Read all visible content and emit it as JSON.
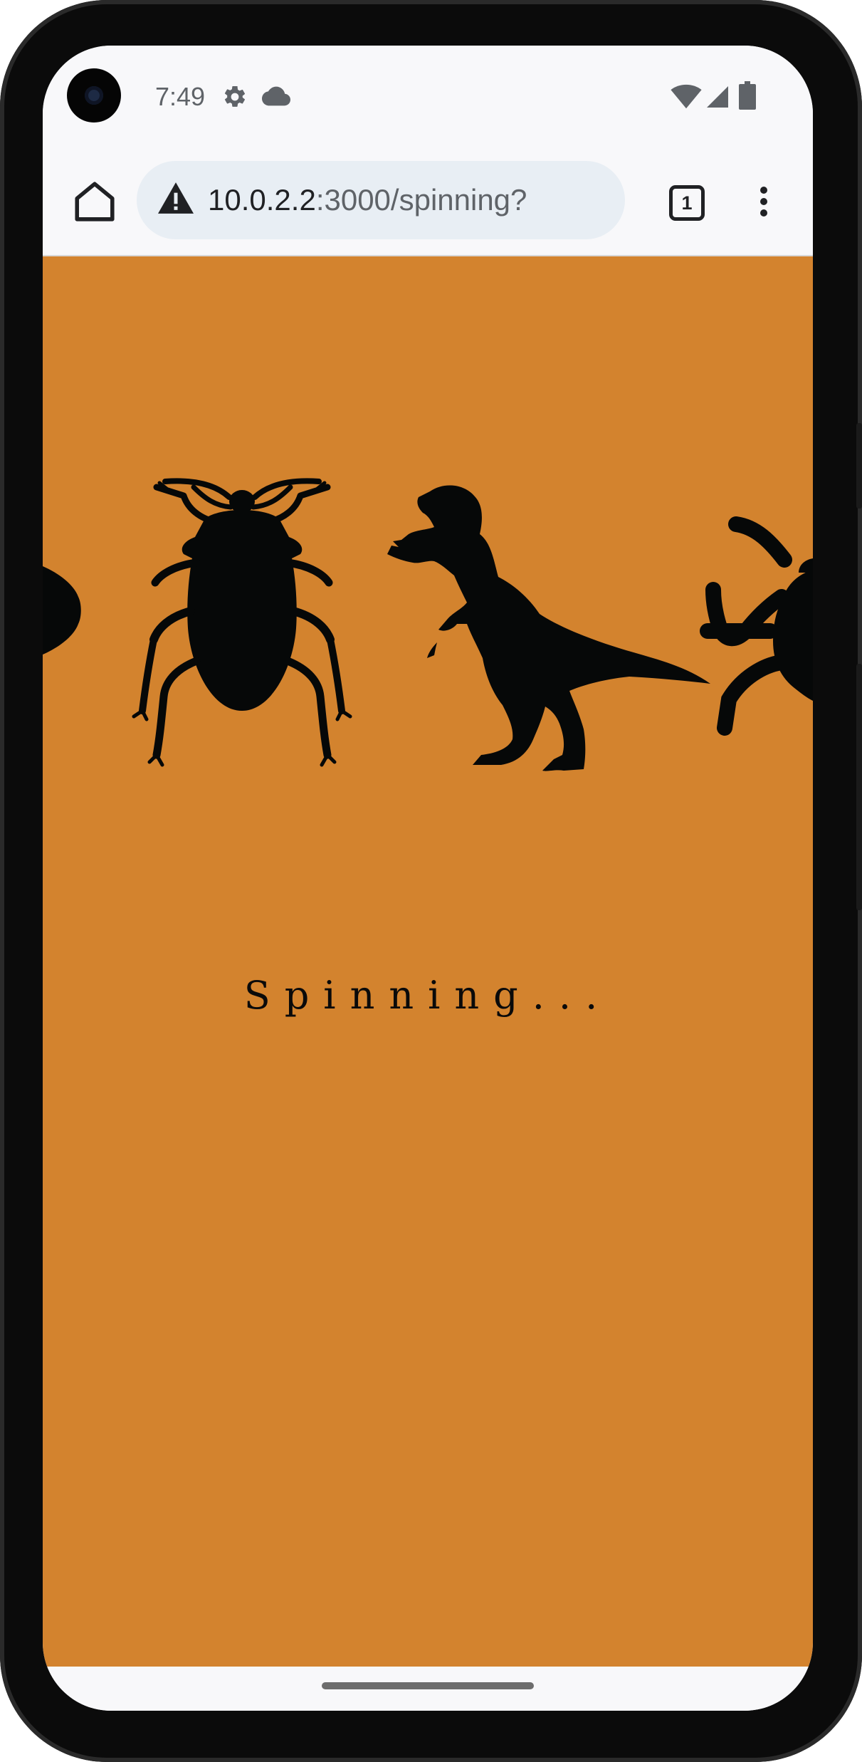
{
  "theme": {
    "background_color": "#d3832e",
    "silhouette_color": "#060808",
    "chrome_color": "#f8f8fa",
    "omnibox_color": "#e8eef4"
  },
  "status_bar": {
    "time": "7:49",
    "left_icons": [
      "settings-gear-icon",
      "cloud-icon"
    ],
    "right_icons": [
      "wifi-icon",
      "cellular-signal-icon",
      "battery-icon"
    ]
  },
  "browser": {
    "home_icon": "home-icon",
    "security_icon": "warning-triangle-icon",
    "url_host": "10.0.2.2",
    "url_path": ":3000/spinning?",
    "tab_count": "1",
    "menu_icon": "more-vert-icon"
  },
  "page": {
    "loading_text": "Spinning...",
    "reel_items": [
      "fish-icon",
      "stink-bug-icon",
      "t-rex-icon",
      "tick-icon"
    ]
  }
}
